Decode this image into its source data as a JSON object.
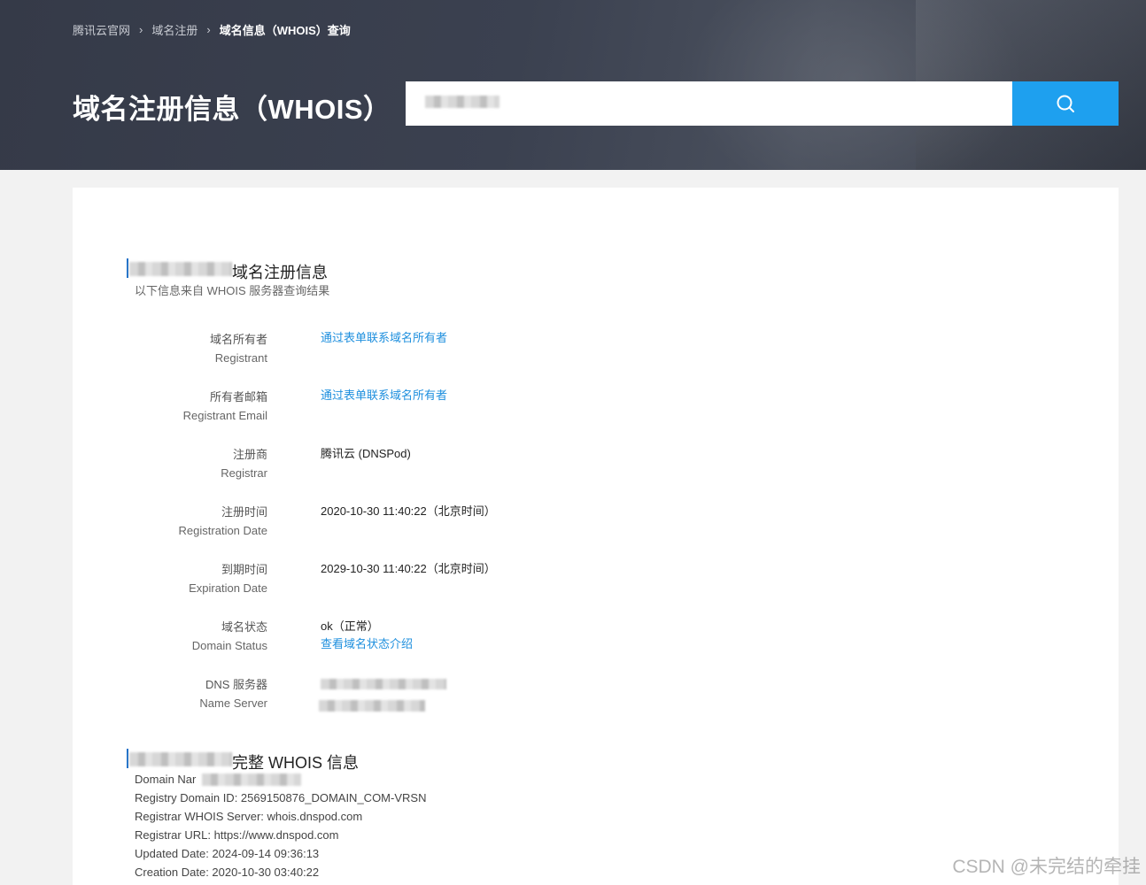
{
  "breadcrumb": {
    "items": [
      "腾讯云官网",
      "域名注册",
      "域名信息（WHOIS）查询"
    ]
  },
  "hero": {
    "title": "域名注册信息（WHOIS）"
  },
  "search": {
    "value": "",
    "icon": "search-icon"
  },
  "registration": {
    "title_suffix": "域名注册信息",
    "subtitle": "以下信息来自 WHOIS 服务器查询结果",
    "rows": [
      {
        "label_cn": "域名所有者",
        "label_en": "Registrant",
        "value": "通过表单联系域名所有者"
      },
      {
        "label_cn": "所有者邮箱",
        "label_en": "Registrant Email",
        "value": "通过表单联系域名所有者"
      },
      {
        "label_cn": "注册商",
        "label_en": "Registrar",
        "value": "腾讯云 (DNSPod)"
      },
      {
        "label_cn": "注册时间",
        "label_en": "Registration Date",
        "value": "2020-10-30 11:40:22（北京时间）"
      },
      {
        "label_cn": "到期时间",
        "label_en": "Expiration Date",
        "value": "2029-10-30 11:40:22（北京时间）"
      },
      {
        "label_cn": "域名状态",
        "label_en": "Domain Status",
        "value": "ok（正常）",
        "link": "查看域名状态介绍"
      },
      {
        "label_cn": "DNS 服务器",
        "label_en": "Name Server",
        "value": ""
      }
    ]
  },
  "whois": {
    "title_suffix": "完整 WHOIS 信息",
    "lines": [
      "Domain Nar",
      "Registry Domain ID: 2569150876_DOMAIN_COM-VRSN",
      "Registrar WHOIS Server: whois.dnspod.com",
      "Registrar URL: https://www.dnspod.com",
      "Updated Date: 2024-09-14 09:36:13",
      "Creation Date: 2020-10-30 03:40:22"
    ]
  },
  "watermark": "CSDN @未完结的牵挂",
  "colors": {
    "accent": "#1ea0ef",
    "link": "#1e8fde",
    "hero_bg": "#3b4150"
  }
}
